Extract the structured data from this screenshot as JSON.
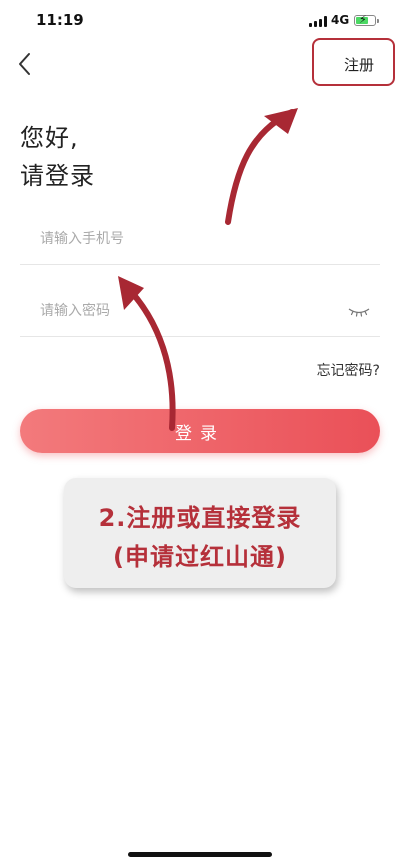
{
  "status_bar": {
    "time": "11:19",
    "network": "4G",
    "battery_level": 0.62,
    "battery_color": "#4cd964"
  },
  "nav": {
    "back_icon": "chevron-left-icon",
    "register_label": "注册"
  },
  "greeting": {
    "line1": "您好,",
    "line2": "请登录"
  },
  "form": {
    "phone_placeholder": "请输入手机号",
    "phone_value": "",
    "password_placeholder": "请输入密码",
    "password_value": "",
    "password_toggle_icon": "eye-closed-icon",
    "forgot_label": "忘记密码?",
    "login_label": "登录"
  },
  "annotation": {
    "line1": "2.注册或直接登录",
    "line2": "(申请过红山通)",
    "accent_color": "#b5303a"
  },
  "theme": {
    "primary_gradient_start": "#f37a7c",
    "primary_gradient_end": "#ea5058"
  }
}
